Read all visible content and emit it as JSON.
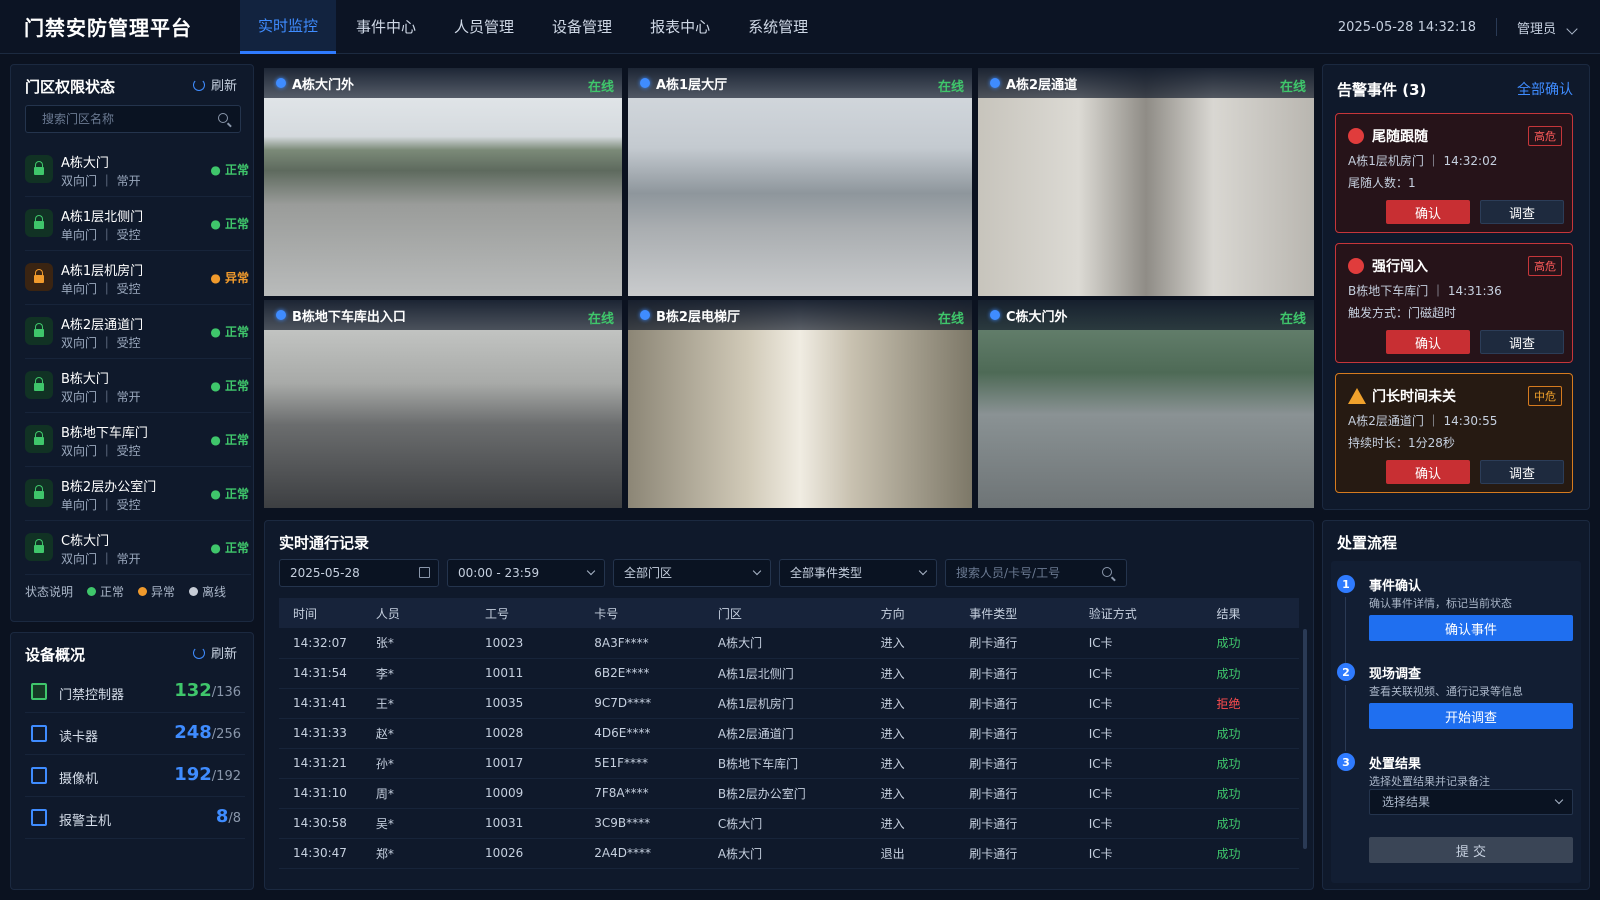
{
  "app_title": "门禁安防管理平台",
  "nav": [
    "实时监控",
    "事件中心",
    "人员管理",
    "设备管理",
    "报表中心",
    "系统管理"
  ],
  "datetime": "2025-05-28 14:32:18",
  "user": "管理员",
  "door_panel": {
    "title": "门区权限状态",
    "refresh": "刷新",
    "search_placeholder": "搜索门区名称",
    "doors": [
      {
        "name": "A栋大门",
        "sub": "双向门 ｜ 常开",
        "status": "正常"
      },
      {
        "name": "A栋1层北侧门",
        "sub": "单向门 ｜ 受控",
        "status": "正常"
      },
      {
        "name": "A栋1层机房门",
        "sub": "单向门 ｜ 受控",
        "status": "异常"
      },
      {
        "name": "A栋2层通道门",
        "sub": "双向门 ｜ 受控",
        "status": "正常"
      },
      {
        "name": "B栋大门",
        "sub": "双向门 ｜ 常开",
        "status": "正常"
      },
      {
        "name": "B栋地下车库门",
        "sub": "双向门 ｜ 受控",
        "status": "正常"
      },
      {
        "name": "B栋2层办公室门",
        "sub": "单向门 ｜ 受控",
        "status": "正常"
      },
      {
        "name": "C栋大门",
        "sub": "双向门 ｜ 常开",
        "status": "正常"
      }
    ],
    "legend_label": "状态说明",
    "legend": [
      {
        "label": "正常",
        "color": "#3fc66b"
      },
      {
        "label": "异常",
        "color": "#f09a2c"
      },
      {
        "label": "离线",
        "color": "#c6ccd6"
      }
    ]
  },
  "device_panel": {
    "title": "设备概况",
    "refresh": "刷新",
    "devices": [
      {
        "name": "门禁控制器",
        "online": "132",
        "total": "/136",
        "color": "#3fc66b"
      },
      {
        "name": "读卡器",
        "online": "248",
        "total": "/256",
        "color": "#3f8cff"
      },
      {
        "name": "摄像机",
        "online": "192",
        "total": "/192",
        "color": "#3f8cff"
      },
      {
        "name": "报警主机",
        "online": "8",
        "total": "/8",
        "color": "#3f8cff"
      }
    ]
  },
  "cameras": [
    {
      "name": "A栋大门外",
      "status": "在线"
    },
    {
      "name": "A栋1层大厅",
      "status": "在线"
    },
    {
      "name": "A栋2层通道",
      "status": "在线"
    },
    {
      "name": "B栋地下车库出入口",
      "status": "在线"
    },
    {
      "name": "B栋2层电梯厅",
      "status": "在线"
    },
    {
      "name": "C栋大门外",
      "status": "在线"
    }
  ],
  "alerts_panel": {
    "title": "告警事件 (3)",
    "confirm_all": "全部确认",
    "alerts": [
      {
        "title": "尾随跟随",
        "level": "高危",
        "line1": "A栋1层机房门 ｜ 14:32:02",
        "line2": "尾随人数：1",
        "confirm": "确认",
        "investigate": "调查"
      },
      {
        "title": "强行闯入",
        "level": "高危",
        "line1": "B栋地下车库门 ｜ 14:31:36",
        "line2": "触发方式：门磁超时",
        "confirm": "确认",
        "investigate": "调查"
      },
      {
        "title": "门长时间未关",
        "level": "中危",
        "line1": "A栋2层通道门 ｜ 14:30:55",
        "line2": "持续时长：1分28秒",
        "confirm": "确认",
        "investigate": "调查"
      }
    ]
  },
  "records": {
    "title": "实时通行记录",
    "date": "2025-05-28",
    "time_range": "00:00 - 23:59",
    "door_filter": "全部门区",
    "event_filter": "全部事件类型",
    "search_placeholder": "搜索人员/卡号/工号",
    "columns": [
      "时间",
      "人员",
      "工号",
      "卡号",
      "门区",
      "方向",
      "事件类型",
      "验证方式",
      "结果"
    ],
    "rows": [
      [
        "14:32:07",
        "张*",
        "10023",
        "8A3F****",
        "A栋大门",
        "进入",
        "刷卡通行",
        "IC卡",
        "成功"
      ],
      [
        "14:31:54",
        "李*",
        "10011",
        "6B2E****",
        "A栋1层北侧门",
        "进入",
        "刷卡通行",
        "IC卡",
        "成功"
      ],
      [
        "14:31:41",
        "王*",
        "10035",
        "9C7D****",
        "A栋1层机房门",
        "进入",
        "刷卡通行",
        "IC卡",
        "拒绝"
      ],
      [
        "14:31:33",
        "赵*",
        "10028",
        "4D6E****",
        "A栋2层通道门",
        "进入",
        "刷卡通行",
        "IC卡",
        "成功"
      ],
      [
        "14:31:21",
        "孙*",
        "10017",
        "5E1F****",
        "B栋地下车库门",
        "进入",
        "刷卡通行",
        "IC卡",
        "成功"
      ],
      [
        "14:31:10",
        "周*",
        "10009",
        "7F8A****",
        "B栋2层办公室门",
        "进入",
        "刷卡通行",
        "IC卡",
        "成功"
      ],
      [
        "14:30:58",
        "吴*",
        "10031",
        "3C9B****",
        "C栋大门",
        "进入",
        "刷卡通行",
        "IC卡",
        "成功"
      ],
      [
        "14:30:47",
        "郑*",
        "10026",
        "2A4D****",
        "A栋大门",
        "退出",
        "刷卡通行",
        "IC卡",
        "成功"
      ]
    ],
    "result_colors": {
      "成功": "#3fc66b",
      "拒绝": "#ff4d4f"
    }
  },
  "process": {
    "title": "处置流程",
    "steps": [
      {
        "num": "1",
        "title": "事件确认",
        "desc": "确认事件详情，标记当前状态",
        "button": "确认事件"
      },
      {
        "num": "2",
        "title": "现场调查",
        "desc": "查看关联视频、通行记录等信息",
        "button": "开始调查"
      },
      {
        "num": "3",
        "title": "处置结果",
        "desc": "选择处置结果并记录备注",
        "button": ""
      }
    ],
    "select_placeholder": "选择结果",
    "submit": "提 交"
  }
}
